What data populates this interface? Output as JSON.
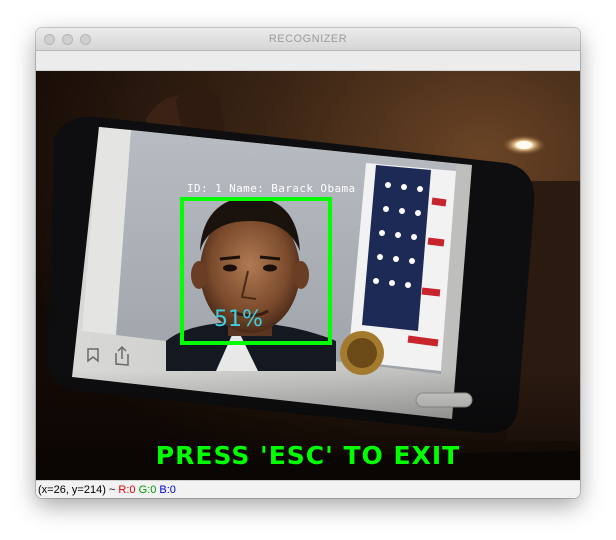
{
  "window": {
    "title": "RECOGNIZER"
  },
  "overlay": {
    "id_label": "ID: 1 Name: Barack Obama",
    "confidence": "51%",
    "instruction": "PRESS 'ESC' TO EXIT"
  },
  "statusbar": {
    "coords": "(x=26, y=214) ~ ",
    "r": "R:0",
    "g": "G:0",
    "b": "B:0"
  },
  "colors": {
    "box": "#00ff00",
    "instruction": "#00ff00",
    "confidence": "#3fd0e0"
  }
}
